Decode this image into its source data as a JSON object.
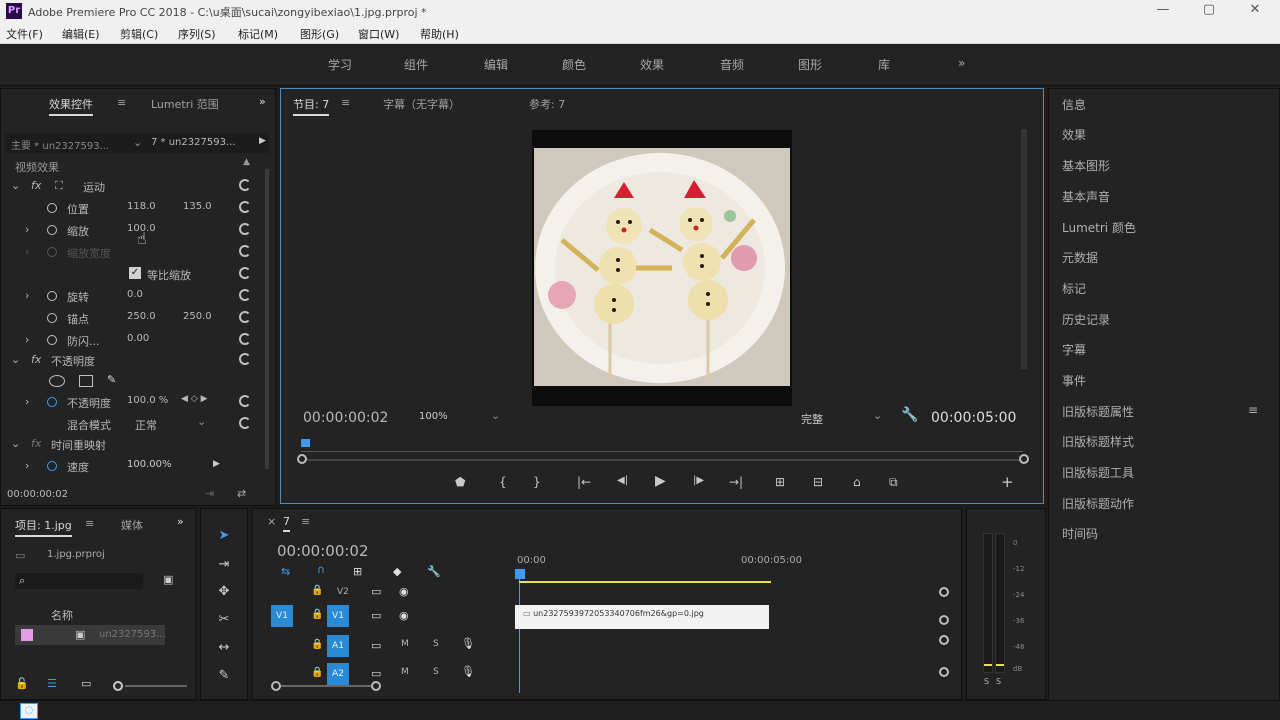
{
  "titlebar": {
    "app_icon": "Pr",
    "title": "Adobe Premiere Pro CC 2018 - C:\\u桌面\\sucai\\zongyibexiao\\1.jpg.prproj *",
    "minimize": "—",
    "maximize": "▢",
    "close": "✕"
  },
  "menubar": [
    "文件(F)",
    "编辑(E)",
    "剪辑(C)",
    "序列(S)",
    "标记(M)",
    "图形(G)",
    "窗口(W)",
    "帮助(H)"
  ],
  "workspaces": [
    "学习",
    "组件",
    "编辑",
    "颜色",
    "效果",
    "音频",
    "图形",
    "库",
    "»"
  ],
  "effect_controls": {
    "tabs": [
      "效果控件",
      "Lumetri 范围"
    ],
    "tab_menu": "≡",
    "overflow": "»",
    "master": "主要 * un2327593...",
    "clip": "7 * un2327593...",
    "section_video": "视频效果",
    "motion": "运动",
    "position_label": "位置",
    "position_x": "118.0",
    "position_y": "135.0",
    "scale_label": "缩放",
    "scale_value": "100.0",
    "scale_width_label": "缩放宽度",
    "uniform_scale_label": "等比缩放",
    "rotation_label": "旋转",
    "rotation_value": "0.0",
    "anchor_label": "锚点",
    "anchor_x": "250.0",
    "anchor_y": "250.0",
    "antiflicker_label": "防闪...",
    "antiflicker_value": "0.00",
    "opacity_section": "不透明度",
    "opacity_label": "不透明度",
    "opacity_value": "100.0 %",
    "blend_label": "混合模式",
    "blend_value": "正常",
    "time_remap": "时间重映射",
    "speed_label": "速度",
    "speed_value": "100.00%",
    "timecode": "00:00:00:02",
    "fx": "fx"
  },
  "program": {
    "tabs": [
      "节目: 7",
      "字幕（无字幕）",
      "参考: 7"
    ],
    "tab_menu": "≡",
    "timecode_left": "00:00:00:02",
    "zoom": "100%",
    "quality": "完整",
    "timecode_right": "00:00:05:00",
    "buttons": [
      "⬟",
      "{",
      "}",
      "|←",
      "◀|",
      "▶",
      "|▶",
      "→|",
      "⊞",
      "⊟",
      "⌂",
      "⧉"
    ],
    "add": "+"
  },
  "right_panel": {
    "items": [
      "信息",
      "效果",
      "基本图形",
      "基本声音",
      "Lumetri 颜色",
      "元数据",
      "标记",
      "历史记录",
      "字幕",
      "事件",
      "旧版标题属性",
      "旧版标题样式",
      "旧版标题工具",
      "旧版标题动作",
      "时间码"
    ],
    "menu_icon": "≡"
  },
  "project": {
    "tabs": [
      "项目: 1.jpg",
      "媒体"
    ],
    "tab_menu": "≡",
    "overflow": "»",
    "file": "1.jpg.prproj",
    "col_name": "名称",
    "item_name": "un2327593..."
  },
  "timeline": {
    "tab": "7",
    "tab_menu": "≡",
    "timecode": "00:00:00:02",
    "ruler": [
      "00:00",
      "00:00:05:00"
    ],
    "tracks_video": [
      "V2",
      "V1"
    ],
    "tracks_audio": [
      "A1",
      "A2"
    ],
    "track_buttons": [
      "V1",
      "A1"
    ],
    "mute": "M",
    "solo": "S",
    "clip_name": "un2327593972053340706fm26&gp=0.jpg",
    "meter_labels": [
      "0",
      "-12",
      "-24",
      "-36",
      "-48",
      "dB"
    ],
    "meter_solo": [
      "S",
      "S"
    ]
  },
  "toolbox": {
    "icons": [
      "selection-tool",
      "track-select-tool",
      "ripple-edit-tool",
      "razor-tool",
      "slip-tool",
      "pen-tool",
      "hand-tool",
      "type-tool"
    ]
  }
}
